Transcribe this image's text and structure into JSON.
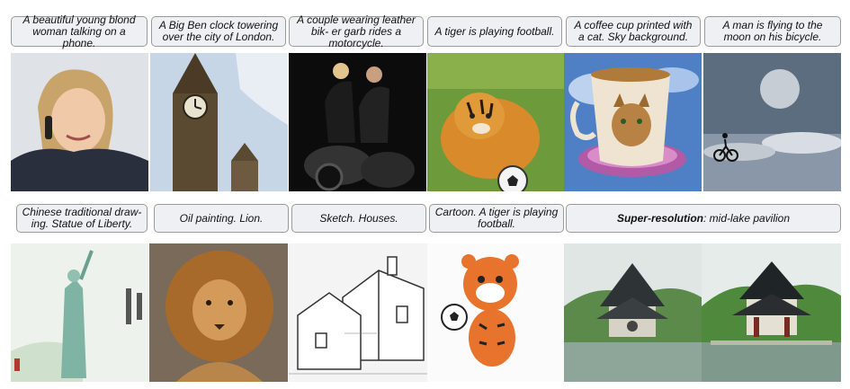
{
  "row1": {
    "captions": [
      "A beautiful young blond woman talking on a phone.",
      "A Big Ben clock towering over the city of London.",
      "A couple wearing leather bik- er garb rides a motorcycle.",
      "A tiger is playing football.",
      "A coffee cup printed with a cat. Sky background.",
      "A man is flying to the moon on his bicycle."
    ],
    "images": [
      "woman-on-phone",
      "big-ben",
      "couple-motorcycle",
      "tiger-football",
      "cat-coffee-cup",
      "man-bicycle-moon"
    ]
  },
  "row2": {
    "captions": [
      "Chinese traditional draw- ing. Statue of Liberty.",
      "Oil painting. Lion.",
      "Sketch. Houses.",
      "Cartoon. A tiger is playing football."
    ],
    "super_resolution": {
      "label": "Super-resolution",
      "text": ": mid-lake pavilion"
    },
    "images": [
      "statue-of-liberty-ink",
      "lion-oil",
      "houses-sketch",
      "cartoon-tiger",
      "pavilion-low-res",
      "pavilion-high-res"
    ]
  }
}
